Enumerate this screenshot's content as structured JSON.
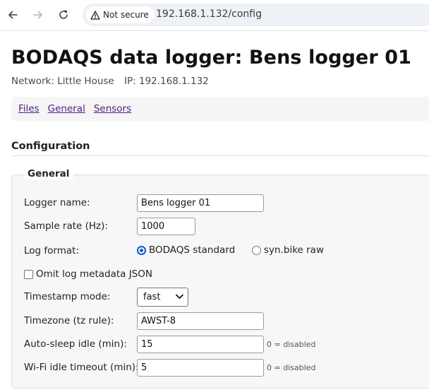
{
  "browser": {
    "security_label": "Not secure",
    "url": "192.168.1.132/config"
  },
  "page": {
    "title": "BODAQS data logger: Bens logger 01",
    "network": "Network: Little House",
    "ip": "IP: 192.168.1.132"
  },
  "nav": {
    "links": [
      "Files",
      "General",
      "Sensors"
    ],
    "link_color": "#551a8b"
  },
  "config": {
    "section_title": "Configuration",
    "legend": "General",
    "logger_name": {
      "label": "Logger name:",
      "value": "Bens logger 01"
    },
    "sample_rate": {
      "label": "Sample rate (Hz):",
      "value": "1000"
    },
    "log_format": {
      "label": "Log format:",
      "options": [
        "BODAQS standard",
        "syn.bike raw"
      ],
      "selected": "BODAQS standard"
    },
    "omit_metadata": {
      "label": "Omit log metadata JSON",
      "checked": false
    },
    "timestamp_mode": {
      "label": "Timestamp mode:",
      "value": "fast"
    },
    "timezone": {
      "label": "Timezone (tz rule):",
      "value": "AWST-8"
    },
    "auto_sleep": {
      "label": "Auto-sleep idle (min):",
      "value": "15",
      "hint": "0 = disabled"
    },
    "wifi_idle": {
      "label": "Wi-Fi idle timeout (min):",
      "value": "5",
      "hint": "0 = disabled"
    }
  },
  "colors": {
    "accent": "#0b57d0",
    "omnibox_bg": "#eef1f6",
    "panel_bg": "#f7f7f7"
  },
  "icons": [
    "back-arrow-icon",
    "forward-arrow-icon",
    "reload-icon",
    "warning-triangle-icon",
    "chevron-down-icon"
  ]
}
